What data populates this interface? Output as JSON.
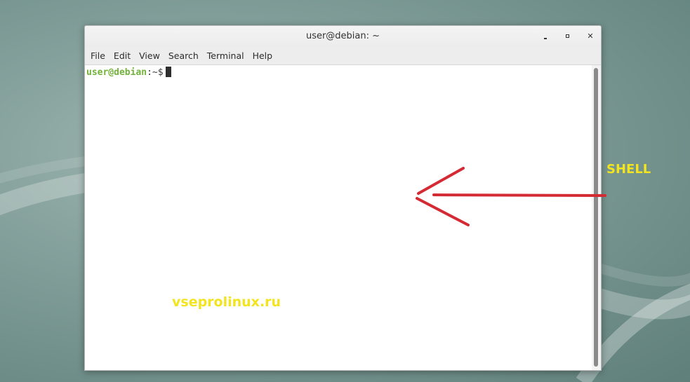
{
  "window": {
    "title": "user@debian: ~",
    "controls": {
      "minimize_icon": "minimize-icon",
      "maximize_icon": "maximize-icon",
      "close_icon": "close-icon",
      "close_glyph": "✕"
    }
  },
  "menubar": {
    "items": [
      "File",
      "Edit",
      "View",
      "Search",
      "Terminal",
      "Help"
    ]
  },
  "terminal": {
    "prompt_user_host": "user@debian",
    "prompt_path": ":~$",
    "colors": {
      "user_host": "#72b23a",
      "background": "#ffffff"
    }
  },
  "annotations": {
    "watermark": "vseprolinux.ru",
    "label": "SHELL",
    "label_color": "#f2e41f",
    "arrow_color": "#d42a33"
  }
}
